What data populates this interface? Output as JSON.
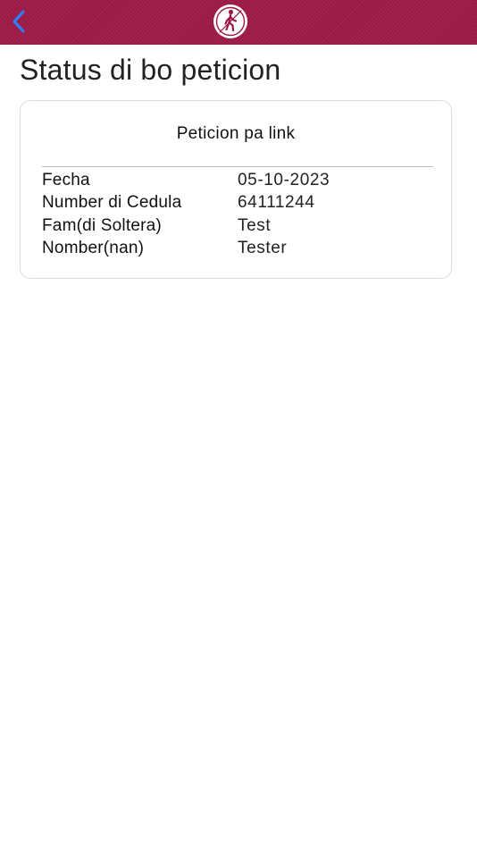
{
  "nav": {
    "back_icon": "chevron-left-icon",
    "logo_icon": "pedestrian-logo-icon",
    "bar_color": "#9b1a45",
    "back_color": "#2f7cf6"
  },
  "page": {
    "title": "Status di bo peticion"
  },
  "card": {
    "title": "Peticion pa link",
    "rows": [
      {
        "label": "Fecha",
        "value": "05-10-2023"
      },
      {
        "label": "Number di Cedula",
        "value": "64111244"
      },
      {
        "label": "Fam(di Soltera)",
        "value": "Test"
      },
      {
        "label": "Nomber(nan)",
        "value": "Tester"
      }
    ]
  }
}
